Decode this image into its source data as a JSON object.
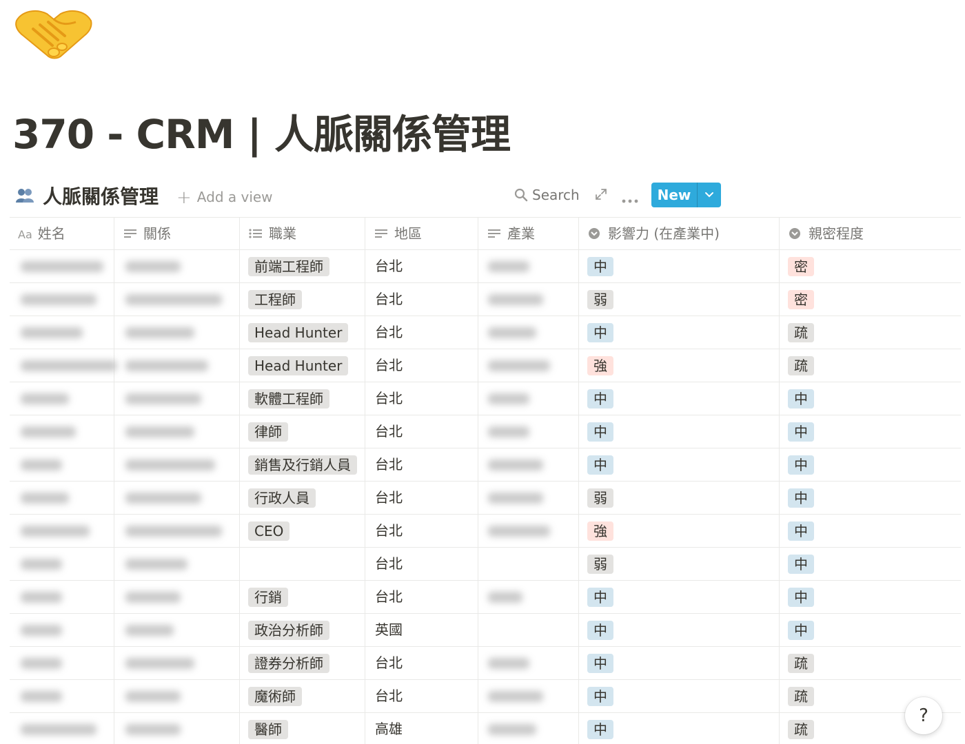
{
  "page": {
    "icon": "handshake-icon",
    "title": "370 - CRM | 人脈關係管理"
  },
  "database": {
    "icon": "people-icon",
    "title": "人脈關係管理",
    "add_view_label": "Add a view",
    "search_label": "Search",
    "new_label": "New"
  },
  "table": {
    "columns": [
      {
        "key": "name",
        "label": "姓名",
        "icon": "text-title-icon"
      },
      {
        "key": "relation",
        "label": "關係",
        "icon": "text-lines-icon"
      },
      {
        "key": "job",
        "label": "職業",
        "icon": "multi-select-icon"
      },
      {
        "key": "region",
        "label": "地區",
        "icon": "text-lines-icon"
      },
      {
        "key": "industry",
        "label": "產業",
        "icon": "text-lines-icon"
      },
      {
        "key": "influence",
        "label": "影響力 (在產業中)",
        "icon": "select-icon"
      },
      {
        "key": "closeness",
        "label": "親密程度",
        "icon": "select-icon"
      }
    ],
    "rows": [
      {
        "job": "前端工程師",
        "region": "台北",
        "influence": "中",
        "closeness": "密"
      },
      {
        "job": "工程師",
        "region": "台北",
        "influence": "弱",
        "closeness": "密"
      },
      {
        "job": "Head Hunter",
        "region": "台北",
        "influence": "中",
        "closeness": "疏"
      },
      {
        "job": "Head Hunter",
        "region": "台北",
        "influence": "強",
        "closeness": "疏"
      },
      {
        "job": "軟體工程師",
        "region": "台北",
        "influence": "中",
        "closeness": "中"
      },
      {
        "job": "律師",
        "region": "台北",
        "influence": "中",
        "closeness": "中"
      },
      {
        "job": "銷售及行銷人員",
        "region": "台北",
        "influence": "中",
        "closeness": "中"
      },
      {
        "job": "行政人員",
        "region": "台北",
        "influence": "弱",
        "closeness": "中"
      },
      {
        "job": "CEO",
        "region": "台北",
        "influence": "強",
        "closeness": "中"
      },
      {
        "job": "",
        "region": "台北",
        "influence": "弱",
        "closeness": "中"
      },
      {
        "job": "行銷",
        "region": "台北",
        "influence": "中",
        "closeness": "中"
      },
      {
        "job": "政治分析師",
        "region": "英國",
        "influence": "中",
        "closeness": "中"
      },
      {
        "job": "證券分析師",
        "region": "台北",
        "influence": "中",
        "closeness": "疏"
      },
      {
        "job": "魔術師",
        "region": "台北",
        "influence": "中",
        "closeness": "疏"
      },
      {
        "job": "醫師",
        "region": "高雄",
        "influence": "中",
        "closeness": "疏"
      }
    ]
  },
  "colors": {
    "new_button": "#2eaadc",
    "tag_default": "#e3e2e0",
    "tag_blue": "#d3e5ef",
    "tag_red": "#ffe2dd",
    "text": "#37352f",
    "muted": "#787774"
  },
  "help": {
    "label": "?"
  }
}
